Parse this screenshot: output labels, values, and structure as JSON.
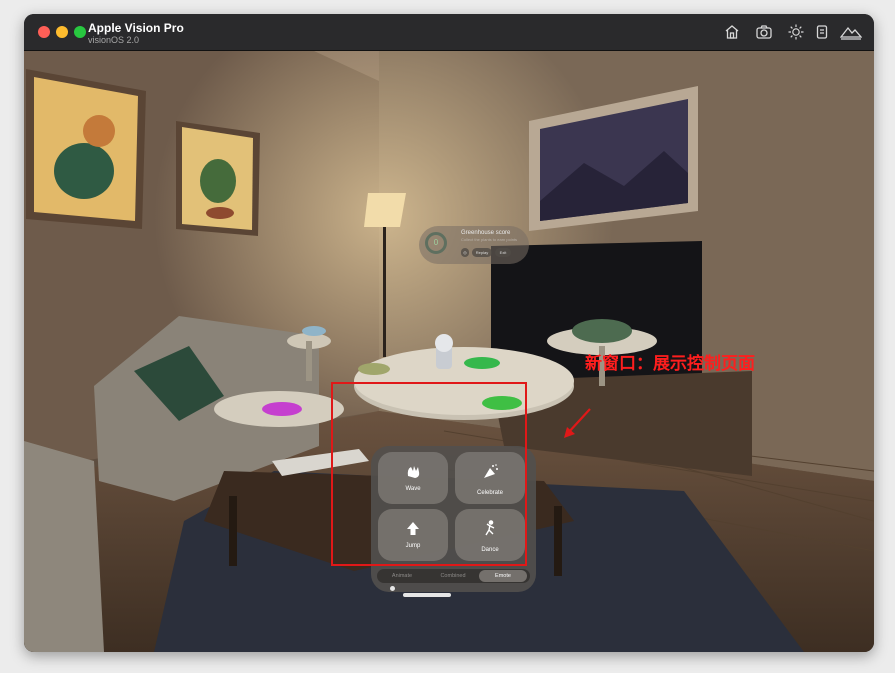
{
  "window": {
    "title": "Apple Vision Pro",
    "subtitle": "visionOS 2.0",
    "toolbar_icons": [
      "home-icon",
      "camera-icon",
      "brightness-icon",
      "device-icon",
      "mountains-icon"
    ]
  },
  "score_panel": {
    "value": "0",
    "title": "Greenhouse score",
    "subtitle": "Collect the plants to earn points",
    "buttons": [
      "Replay",
      "Exit"
    ]
  },
  "annotation": {
    "text": "新窗口：展示控制页面",
    "color": "#ff1e1e"
  },
  "control_panel": {
    "tiles": [
      {
        "label": "Wave",
        "icon": "hand-wave-icon"
      },
      {
        "label": "Celebrate",
        "icon": "party-popper-icon"
      },
      {
        "label": "Jump",
        "icon": "arrow-up-icon"
      },
      {
        "label": "Dance",
        "icon": "dancing-figure-icon"
      }
    ],
    "tabs": [
      "Animate",
      "Combined",
      "Emote"
    ],
    "selected_tab": "Emote"
  },
  "colors": {
    "accent_red": "#e01818",
    "traffic_red": "#ff5f57",
    "traffic_yellow": "#febc2e",
    "traffic_green": "#28c840"
  }
}
